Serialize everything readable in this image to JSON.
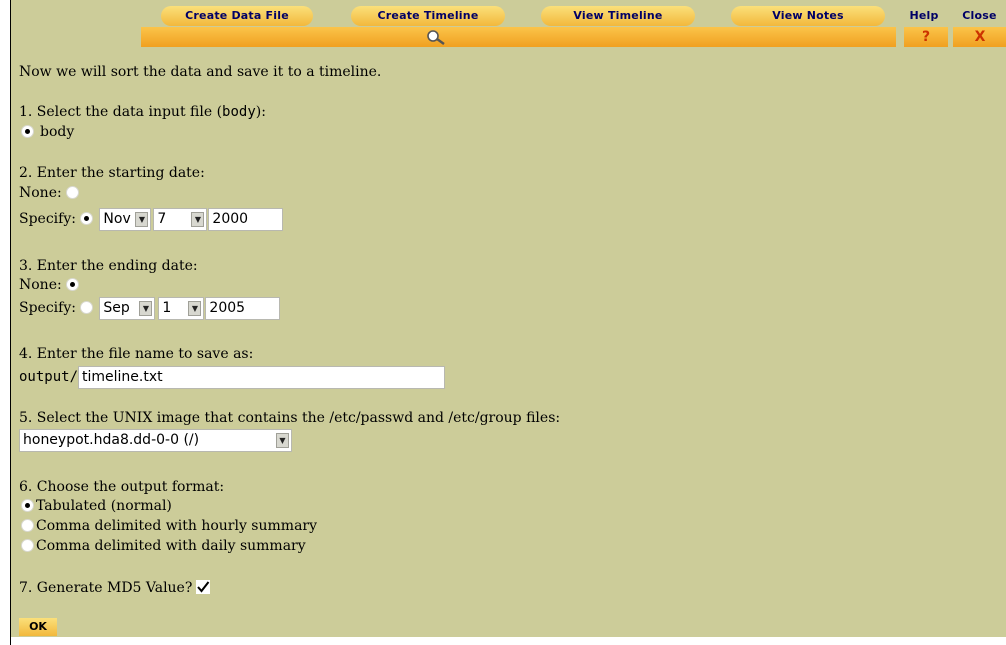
{
  "nav": {
    "create_data_file": "Create Data File",
    "create_timeline": "Create Timeline",
    "view_timeline": "View Timeline",
    "view_notes": "View Notes",
    "help": "Help",
    "close": "Close",
    "help_symbol": "?",
    "close_symbol": "X",
    "search_icon": "magnifier-icon",
    "accent_color": "#f2b83c",
    "text_color": "#000066",
    "background": "#cccc99"
  },
  "intro": "Now we will sort the data and save it to a timeline.",
  "step1": {
    "label_prefix": "1. Select the data input file (",
    "label_mono": "body",
    "label_suffix": "):",
    "option": "body",
    "selected": true
  },
  "step2": {
    "label": "2. Enter the starting date:",
    "none_label": "None:",
    "specify_label": "Specify:",
    "mode": "specify",
    "month": "Nov",
    "day": "7",
    "year": "2000"
  },
  "step3": {
    "label": "3. Enter the ending date:",
    "none_label": "None:",
    "specify_label": "Specify:",
    "mode": "none",
    "month": "Sep",
    "day": "1",
    "year": "2005"
  },
  "step4": {
    "label": "4. Enter the file name to save as:",
    "prefix": "output/",
    "value": "timeline.txt"
  },
  "step5": {
    "label": "5. Select the UNIX image that contains the /etc/passwd and /etc/group files:",
    "selected": "honeypot.hda8.dd-0-0 (/)"
  },
  "step6": {
    "label": "6. Choose the output format:",
    "options": [
      "Tabulated (normal)",
      "Comma delimited with hourly summary",
      "Comma delimited with daily summary"
    ],
    "selected_index": 0
  },
  "step7": {
    "label": "7. Generate MD5 Value?",
    "checked": true
  },
  "ok_label": "OK"
}
